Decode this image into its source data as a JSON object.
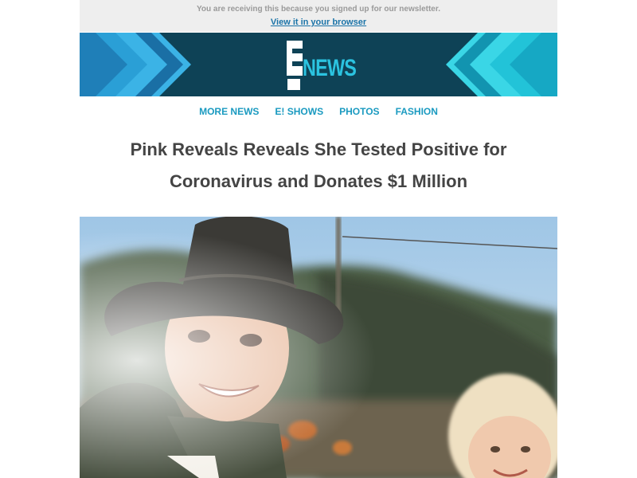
{
  "preheader": {
    "text": "You are receiving this because you signed up for our newsletter.",
    "link": "View it in your browser"
  },
  "banner": {
    "logo_letter": "E",
    "logo_word": "NEWS",
    "logo_icon": "e-news-logo"
  },
  "nav": {
    "items": [
      "MORE NEWS",
      "E! SHOWS",
      "PHOTOS",
      "FASHION"
    ]
  },
  "article": {
    "headline_line1": "Pink Reveals Reveals She Tested Positive for",
    "headline_line2": "Coronavirus and Donates $1 Million"
  },
  "colors": {
    "banner_bg": "#0e4256",
    "chevron_blue": "#2a9fd6",
    "chevron_teal": "#22c3d8",
    "logo_accent": "#2bc3e0",
    "nav_link": "#1a9ac0",
    "headline": "#444444",
    "preheader_bg": "#eeeeee"
  }
}
